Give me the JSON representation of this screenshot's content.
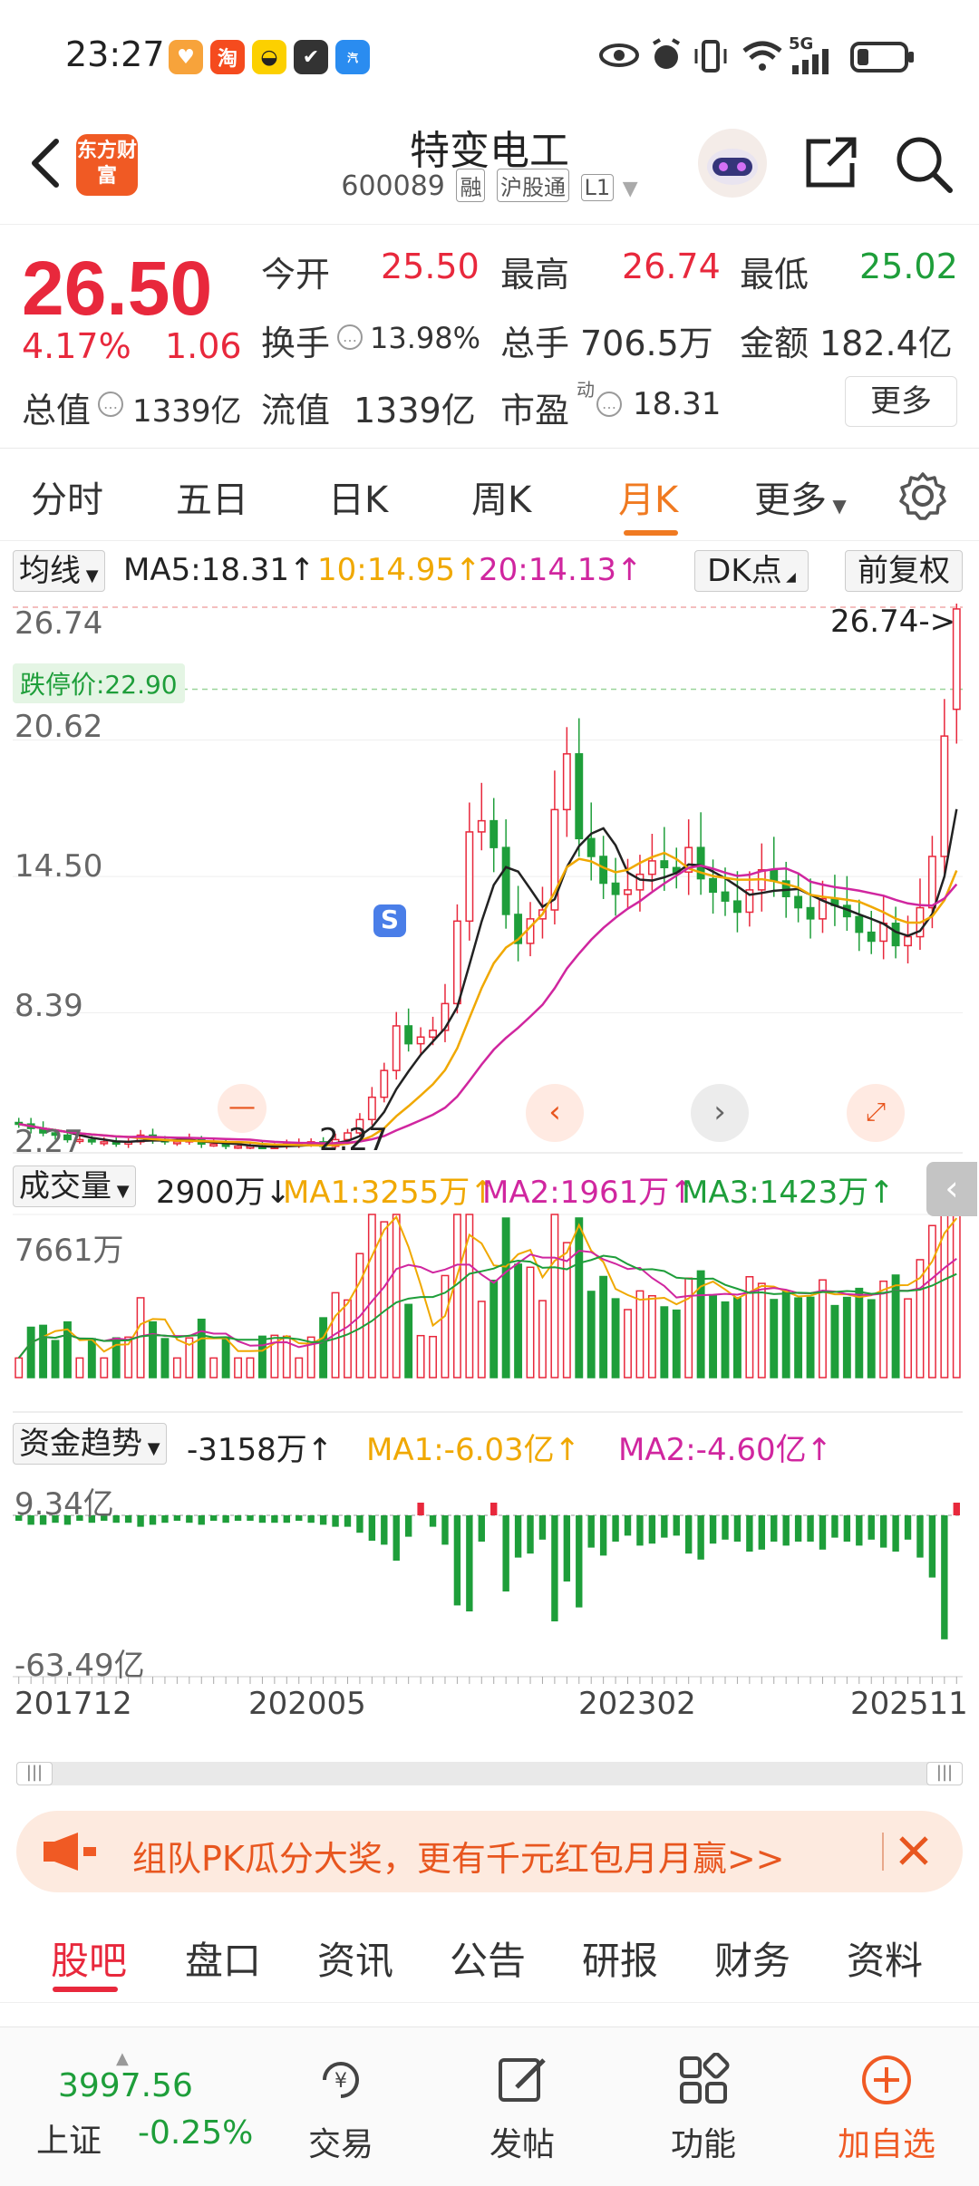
{
  "status": {
    "time": "23:27",
    "network": "5G",
    "icons": [
      "heart-app-icon",
      "taobao-icon",
      "app-icon",
      "shield-icon",
      "car-app-icon",
      "eye-icon",
      "alarm-icon",
      "vibrate-icon",
      "wifi-icon",
      "signal-icon",
      "battery-icon"
    ]
  },
  "header": {
    "logo": "东方财富",
    "name": "特变电工",
    "code": "600089",
    "tags": [
      "融",
      "沪股通",
      "L1"
    ]
  },
  "quote": {
    "price": "26.50",
    "pct": "4.17%",
    "change": "1.06",
    "open_label": "今开",
    "open": "25.50",
    "high_label": "最高",
    "high": "26.74",
    "low_label": "最低",
    "low": "25.02",
    "turnover_label": "换手",
    "turnover": "13.98%",
    "vol_label": "总手",
    "vol": "706.5万",
    "amount_label": "金额",
    "amount": "182.4亿",
    "mcap_label": "总值",
    "mcap": "1339亿",
    "float_label": "流值",
    "float": "1339亿",
    "pe_label": "市盈",
    "pe_sup": "动",
    "pe": "18.31",
    "more": "更多"
  },
  "period_tabs": [
    "分时",
    "五日",
    "日K",
    "周K",
    "月K",
    "更多"
  ],
  "ma": {
    "select": "均线",
    "ma5": "MA5:18.31",
    "ma10": "10:14.95",
    "ma20": "20:14.13",
    "dk": "DK点",
    "adj": "前复权"
  },
  "price_axis": {
    "max": "26.74",
    "y2": "20.62",
    "y3": "14.50",
    "y4": "8.39",
    "min": "2.27",
    "limit_down": "跌停价:22.90",
    "high_marker": "26.74->",
    "low_marker": "2.27"
  },
  "volume": {
    "select": "成交量",
    "current": "2900万",
    "ma1": "MA1:3255万",
    "ma2": "MA2:1961万",
    "ma3": "MA3:1423万",
    "max": "7661万"
  },
  "money": {
    "select": "资金趋势",
    "current": "-3158万",
    "ma1": "MA1:-6.03亿",
    "ma2": "MA2:-4.60亿",
    "top": "9.34亿",
    "bottom": "-63.49亿"
  },
  "x_axis": [
    "201712",
    "202005",
    "202302",
    "202511"
  ],
  "banner": {
    "text": "组队PK瓜分大奖，更有千元红包月月赢>>"
  },
  "content_tabs": [
    "股吧",
    "盘口",
    "资讯",
    "公告",
    "研报",
    "财务",
    "资料"
  ],
  "bottom": {
    "index_value": "3997.56",
    "index_name": "上证",
    "index_change": "-0.25%",
    "trade": "交易",
    "post": "发帖",
    "func": "功能",
    "watch": "加自选"
  },
  "colors": {
    "up": "#e8283c",
    "down": "#1e9e3a",
    "accent": "#f07a21",
    "ma5": "#222222",
    "ma10": "#f0a800",
    "ma20": "#d0269f"
  },
  "chart_data": {
    "type": "candlestick",
    "period": "monthly",
    "y_range": [
      2.27,
      26.74
    ],
    "x_ticks": [
      "201712",
      "202005",
      "202302",
      "202511"
    ],
    "close_approx": [
      3.4,
      3.2,
      3.0,
      2.9,
      2.7,
      2.7,
      2.6,
      2.6,
      2.5,
      2.6,
      2.9,
      2.7,
      2.6,
      2.6,
      2.7,
      2.5,
      2.5,
      2.4,
      2.4,
      2.4,
      2.3,
      2.4,
      2.5,
      2.5,
      2.6,
      2.4,
      2.7,
      3.0,
      3.6,
      4.6,
      5.8,
      7.8,
      7.0,
      7.3,
      7.6,
      8.8,
      12.5,
      16.5,
      17.0,
      15.8,
      12.8,
      11.5,
      12.6,
      13.0,
      17.5,
      20.0,
      16.2,
      15.4,
      14.2,
      13.7,
      13.9,
      14.6,
      15.2,
      14.9,
      14.7,
      15.8,
      14.4,
      13.8,
      13.4,
      12.9,
      13.9,
      14.8,
      14.3,
      13.6,
      13.1,
      12.6,
      13.5,
      13.2,
      12.7,
      12.0,
      11.6,
      12.4,
      11.4,
      11.8,
      13.1,
      15.4,
      20.8,
      26.5
    ]
  }
}
